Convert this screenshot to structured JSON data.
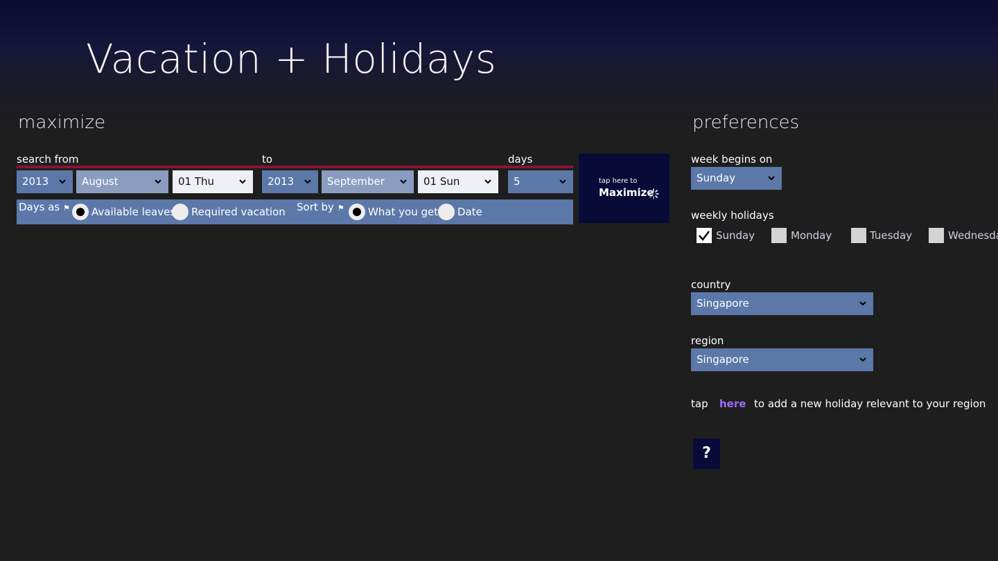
{
  "app": {
    "title": "Vacation + Holidays"
  },
  "maximize": {
    "section_title": "maximize",
    "search_from_label": "search from",
    "to_label": "to",
    "days_label": "days",
    "from_year": "2013",
    "from_month": "August",
    "from_day": "01 Thu",
    "to_year": "2013",
    "to_month": "September",
    "to_day": "01 Sun",
    "days_value": "5",
    "days_as_label": "Days as",
    "days_as_options": [
      {
        "label": "Available leaves",
        "selected": true
      },
      {
        "label": "Required vacation",
        "selected": false
      }
    ],
    "sort_by_label": "Sort by",
    "sort_by_options": [
      {
        "label": "What you get",
        "selected": true
      },
      {
        "label": "Date",
        "selected": false
      }
    ],
    "tile_small": "tap here to",
    "tile_big": "Maximize"
  },
  "preferences": {
    "section_title": "preferences",
    "week_begins_label": "week begins on",
    "week_begins_value": "Sunday",
    "weekly_holidays_label": "weekly holidays",
    "weekly_holidays": [
      {
        "label": "Sunday",
        "checked": true
      },
      {
        "label": "Monday",
        "checked": false
      },
      {
        "label": "Tuesday",
        "checked": false
      },
      {
        "label": "Wednesday",
        "checked": false
      }
    ],
    "country_label": "country",
    "country_value": "Singapore",
    "region_label": "region",
    "region_value": "Singapore",
    "tap_text": "tap",
    "here_link": "here",
    "add_holiday_text": "to add a new holiday relevant to your region",
    "help_label": "?"
  },
  "colors": {
    "accent_red": "#8a1434",
    "control_blue": "#5b78a8",
    "tile_navy": "#080a38",
    "link_purple": "#9b6bff"
  },
  "icons": {
    "dropdown": "chevron-down-icon",
    "flag": "flag-icon",
    "spinner": "spinner-icon",
    "check": "checkmark-icon"
  }
}
